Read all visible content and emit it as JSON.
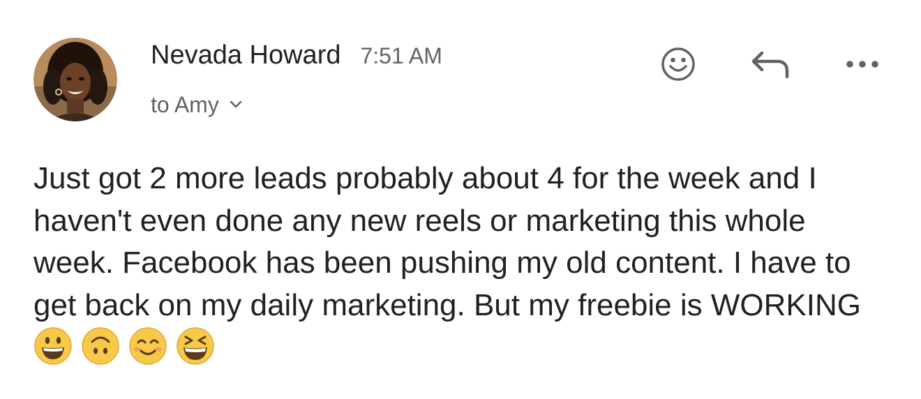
{
  "message": {
    "sender": "Nevada Howard",
    "time": "7:51 AM",
    "recipient": "to Amy",
    "body": "Just got 2 more leads probably about 4 for the week and I haven't even done any new reels or marketing this whole week. Facebook has been pushing my old content. I have to get back on my daily marketing. But my freebie is WORKING",
    "emojis": [
      "grinning-face",
      "upside-down-face",
      "smiling-face-with-smiling-eyes",
      "grinning-squinting-face"
    ]
  },
  "actions": {
    "react_icon": "smiley-icon",
    "reply_icon": "reply-arrow-icon",
    "more_icon": "more-horizontal-icon"
  },
  "recipient_dropdown_icon": "chevron-down-icon",
  "colors": {
    "text": "#202124",
    "secondary": "#5f6368",
    "icon": "#5f6368",
    "emoji": "#f7c948"
  }
}
